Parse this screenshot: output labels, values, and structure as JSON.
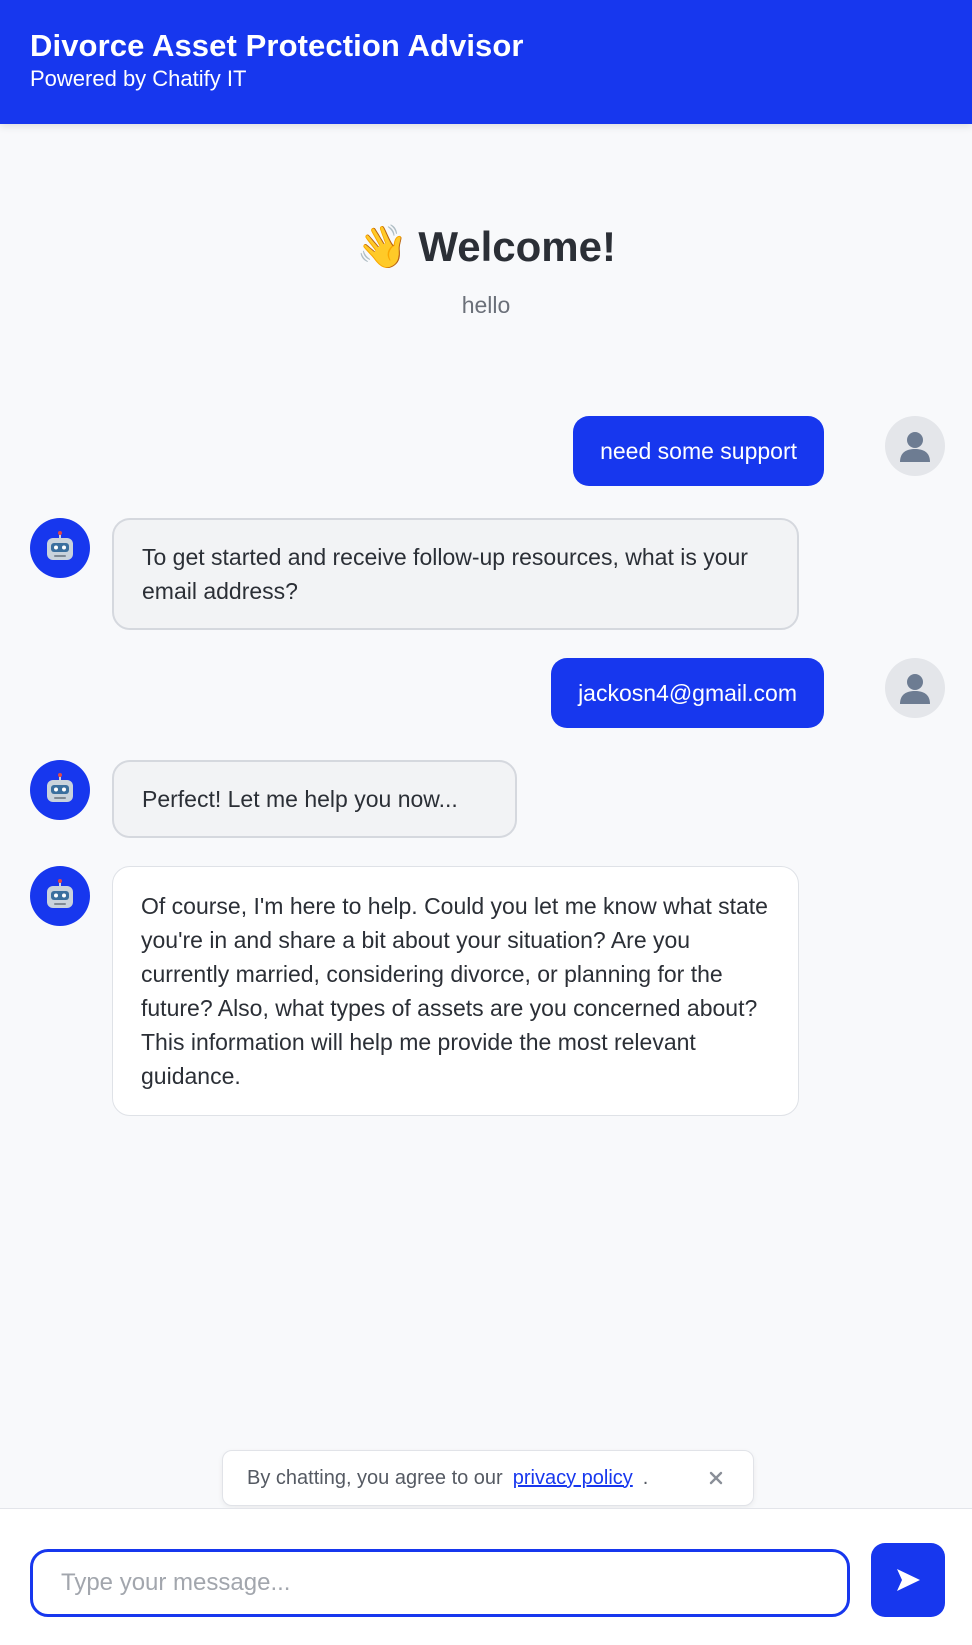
{
  "header": {
    "title": "Divorce Asset Protection Advisor",
    "subtitle": "Powered by Chatify IT"
  },
  "welcome": {
    "icon": "waving-hand-icon",
    "emoji": "👋",
    "title": "Welcome!",
    "subtitle": "hello"
  },
  "messages": [
    {
      "role": "user",
      "text": "need some support"
    },
    {
      "role": "bot",
      "text": "To get started and receive follow-up resources, what is your email address?"
    },
    {
      "role": "user",
      "text": "jackosn4@gmail.com"
    },
    {
      "role": "bot",
      "text": "Perfect! Let me help you now..."
    },
    {
      "role": "bot",
      "text": "Of course, I'm here to help. Could you let me know what state you're in and share a bit about your situation? Are you currently married, considering divorce, or planning for the future? Also, what types of assets are you concerned about? This information will help me provide the most relevant guidance."
    }
  ],
  "privacy": {
    "text": "By chatting, you agree to our",
    "link_label": "privacy policy",
    "period": "."
  },
  "composer": {
    "value": "",
    "placeholder": "Type your message..."
  },
  "colors": {
    "accent": "#1737ee",
    "background": "#f8f9fb"
  }
}
